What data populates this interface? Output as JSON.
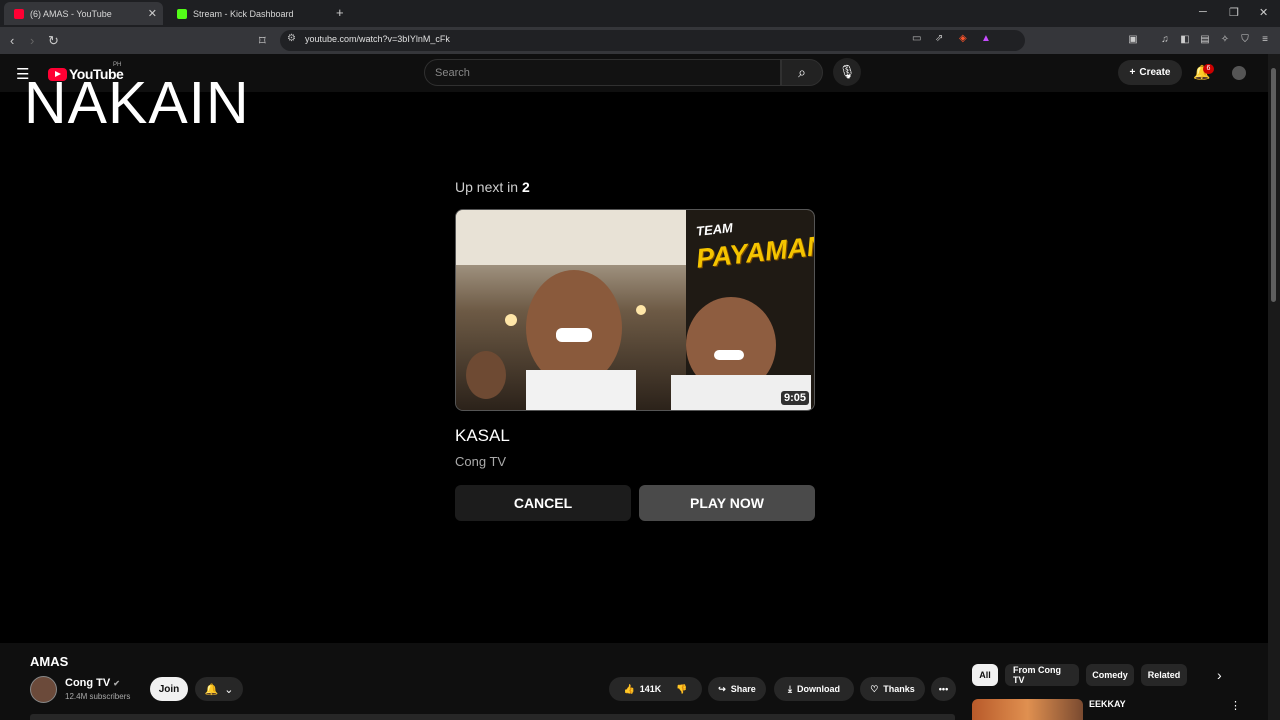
{
  "browser": {
    "tabs": [
      {
        "title": "(6) AMAS - YouTube",
        "active": true,
        "icon": "youtube-favicon"
      },
      {
        "title": "Stream - Kick Dashboard",
        "active": false,
        "icon": "kick-favicon"
      }
    ],
    "url": "youtube.com/watch?v=3bIYlnM_cFk"
  },
  "youtube": {
    "logo_text": "YouTube",
    "country_code": "PH",
    "search_placeholder": "Search",
    "create_label": "Create",
    "notification_count": "6"
  },
  "overlay_text": "NAKAIN",
  "up_next": {
    "prefix": "Up next in",
    "countdown": "2",
    "thumbnail_text_1": "TEAM",
    "thumbnail_text_2": "PAYAMAN",
    "duration": "9:05",
    "title": "KASAL",
    "channel": "Cong TV",
    "cancel_label": "CANCEL",
    "play_label": "PLAY NOW"
  },
  "video": {
    "title": "AMAS",
    "channel": "Cong TV",
    "subscribers": "12.4M subscribers",
    "join_label": "Join",
    "likes": "141K",
    "share_label": "Share",
    "download_label": "Download",
    "thanks_label": "Thanks"
  },
  "chips": [
    "All",
    "From Cong TV",
    "Comedy",
    "Related"
  ],
  "recommendation": {
    "title": "EEKKAY"
  },
  "colors": {
    "youtube_red": "#ff0033",
    "background": "#0f0f0f",
    "accent_yellow": "#f5c400"
  }
}
